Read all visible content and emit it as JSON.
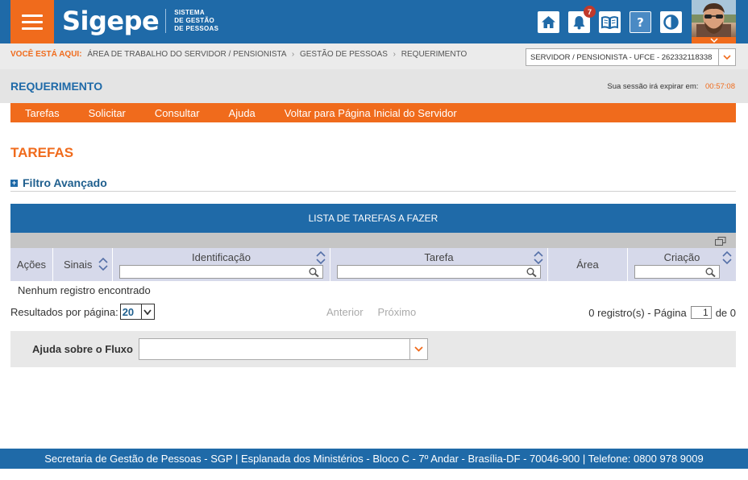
{
  "header": {
    "logo": "Sigepe",
    "logo_sub_1": "SISTEMA",
    "logo_sub_2": "DE GESTÃO",
    "logo_sub_3": "DE PESSOAS",
    "notifications_count": "7"
  },
  "breadcrumb": {
    "lead": "VOCÊ ESTÁ AQUI:",
    "items": [
      "ÁREA DE TRABALHO DO SERVIDOR / PENSIONISTA",
      "GESTÃO DE PESSOAS",
      "REQUERIMENTO"
    ]
  },
  "profile_select": {
    "value": "SERVIDOR / PENSIONISTA - UFCE - 262332118338"
  },
  "titlebar": {
    "title": "REQUERIMENTO",
    "session_label": "Sua sessão irá expirar em:",
    "session_time": "00:57:08"
  },
  "nav": [
    "Tarefas",
    "Solicitar",
    "Consultar",
    "Ajuda",
    "Voltar para Página Inicial do Servidor"
  ],
  "main": {
    "section_title": "TAREFAS",
    "filter_label": "Filtro Avançado"
  },
  "table": {
    "caption": "LISTA DE TAREFAS A FAZER",
    "columns": {
      "acoes": "Ações",
      "sinais": "Sinais",
      "identificacao": "Identificação",
      "tarefa": "Tarefa",
      "area": "Área",
      "criacao": "Criação"
    },
    "empty_message": "Nenhum registro encontrado"
  },
  "pager": {
    "per_page_label": "Resultados por página:",
    "per_page_value": "20",
    "prev": "Anterior",
    "next": "Próximo",
    "records_text": "0 registro(s) - Página",
    "current_page": "1",
    "of_text": "de 0"
  },
  "flow": {
    "label": "Ajuda sobre o Fluxo"
  },
  "footer": {
    "text": "Secretaria de Gestão de Pessoas - SGP | Esplanada dos Ministérios - Bloco C - 7º Andar - Brasília-DF - 70046-900 | Telefone: 0800 978 9009"
  },
  "colors": {
    "brand_blue": "#1f6aa8",
    "accent_orange": "#f06b1c"
  }
}
